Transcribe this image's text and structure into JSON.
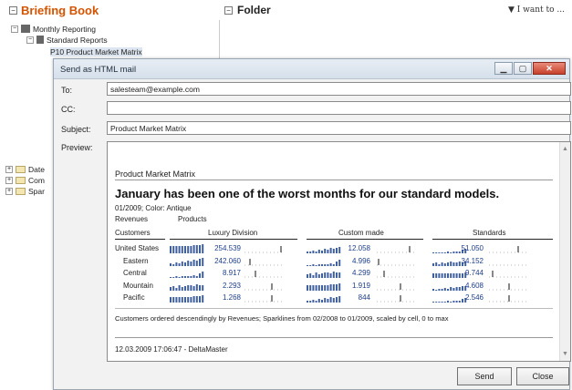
{
  "briefing_book": {
    "title": "Briefing Book",
    "i_want_to": "▼ I want to ...",
    "folder_title": "Folder",
    "tree": [
      {
        "label": "Monthly Reporting",
        "indent": 0
      },
      {
        "label": "Standard Reports",
        "indent": 1
      },
      {
        "label": "P10 Product Market Matrix",
        "indent": 2
      }
    ],
    "tree_partial": [
      "Date",
      "Com",
      "Spar"
    ]
  },
  "dialog": {
    "title": "Send as HTML mail",
    "to_label": "To:",
    "to_value": "salesteam@example.com",
    "cc_label": "CC:",
    "cc_value": "",
    "subject_label": "Subject:",
    "subject_value": "Product Market Matrix",
    "preview_label": "Preview:",
    "send_label": "Send",
    "close_label": "Close"
  },
  "report": {
    "title": "Product Market Matrix",
    "headline": "January has been one of the worst months for our standard models.",
    "meta": "01/2009; Color: Antique",
    "revenues": "Revenues",
    "products": "Products",
    "customers": "Customers",
    "columns": [
      "Luxury Division",
      "Custom made",
      "Standards"
    ],
    "rows": [
      {
        "name": "United States",
        "values": [
          "254.539",
          "12.058",
          "51.050"
        ]
      },
      {
        "name": "Eastern",
        "values": [
          "242.060",
          "4.996",
          "34.152"
        ]
      },
      {
        "name": "Central",
        "values": [
          "8.917",
          "4.299",
          "9.744"
        ]
      },
      {
        "name": "Mountain",
        "values": [
          "2.293",
          "1.919",
          "4.608"
        ]
      },
      {
        "name": "Pacific",
        "values": [
          "1.268",
          "844",
          "2.546"
        ]
      }
    ],
    "footnote": "Customers ordered descendingly by Revenues; Sparklines from 02/2008 to 01/2009, scaled by cell, 0 to max",
    "timestamp": "12.03.2009 17:06:47 - DeltaMaster"
  }
}
